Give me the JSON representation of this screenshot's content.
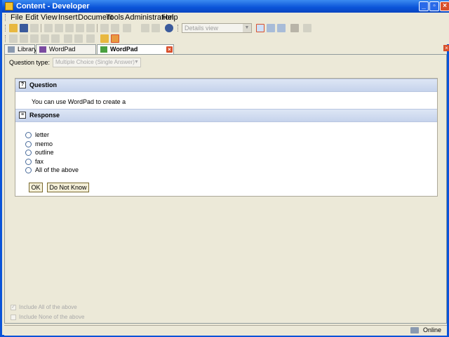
{
  "window": {
    "title": "Content - Developer"
  },
  "menu": [
    "File",
    "Edit",
    "View",
    "Insert",
    "Document",
    "Tools",
    "Administration",
    "Help"
  ],
  "toolbar": {
    "view_select": "Details view"
  },
  "tabs": [
    {
      "label": "Library"
    },
    {
      "label": "WordPad Training"
    },
    {
      "label": "WordPad Documents"
    }
  ],
  "question_type": {
    "label": "Question type:",
    "value": "Multiple Choice (Single Answer)"
  },
  "question": {
    "header": "Question",
    "text": "You can use WordPad to create a"
  },
  "response": {
    "header": "Response",
    "options": [
      "letter",
      "memo",
      "outline",
      "fax",
      "All of the above"
    ],
    "ok_label": "OK",
    "dont_know_label": "Do Not Know"
  },
  "bottom_options": [
    {
      "label": "Include All of the above",
      "checked": true
    },
    {
      "label": "Include None of the above",
      "checked": false
    }
  ],
  "status": {
    "text": "Online"
  },
  "colors": {
    "title_bar": "#0a53d8",
    "section_header": "#c6d3ec",
    "close_red": "#d9502c"
  }
}
